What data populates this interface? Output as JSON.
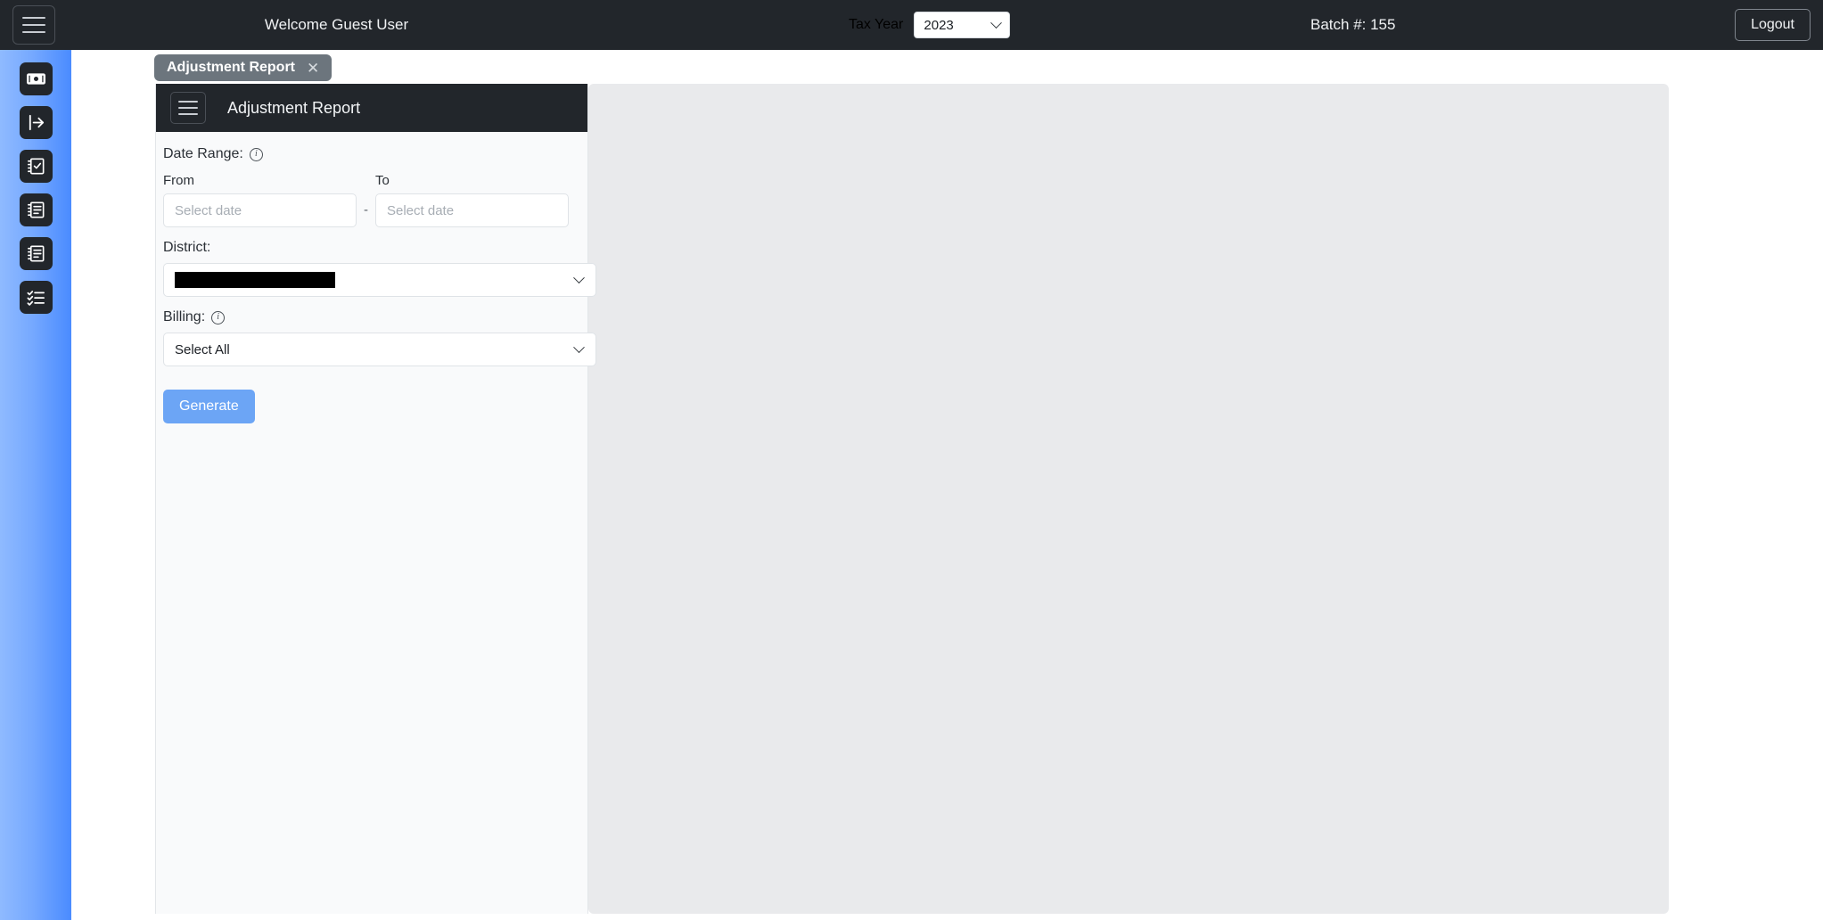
{
  "topbar": {
    "menu_icon": "hamburger-icon",
    "welcome": "Welcome Guest User",
    "tax_year_label": "Tax Year",
    "tax_year_value": "2023",
    "tax_year_options": [
      "2023"
    ],
    "batch": "Batch #: 155",
    "logout_label": "Logout"
  },
  "sidebar": {
    "items": [
      {
        "icon": "banknote-icon"
      },
      {
        "icon": "login-arrow-icon"
      },
      {
        "icon": "clipboard-check-icon"
      },
      {
        "icon": "document-list-icon"
      },
      {
        "icon": "document-list-alt-icon"
      },
      {
        "icon": "checklist-icon"
      }
    ]
  },
  "tabs": [
    {
      "label": "Adjustment Report",
      "close_icon": "close-icon",
      "active": true
    }
  ],
  "card": {
    "menu_icon": "hamburger-icon",
    "title": "Adjustment Report"
  },
  "form": {
    "date_range_label": "Date Range:",
    "date_range_info_icon": "info-icon",
    "from_label": "From",
    "to_label": "To",
    "from_value": "",
    "from_placeholder": "Select date",
    "to_value": "",
    "to_placeholder": "Select date",
    "range_separator": "-",
    "district_label": "District:",
    "district_value": "",
    "district_redacted": true,
    "billing_label": "Billing:",
    "billing_info_icon": "info-icon",
    "billing_value": "Select All",
    "generate_label": "Generate"
  },
  "colors": {
    "topbar_bg": "#22262b",
    "rail_gradient_start": "#8fbaff",
    "rail_gradient_end": "#4a8bff",
    "tab_bg": "#6c757d",
    "accent_button": "#6ca5f5",
    "panel_bg": "#e9eaec",
    "form_bg": "#f9fafb"
  }
}
